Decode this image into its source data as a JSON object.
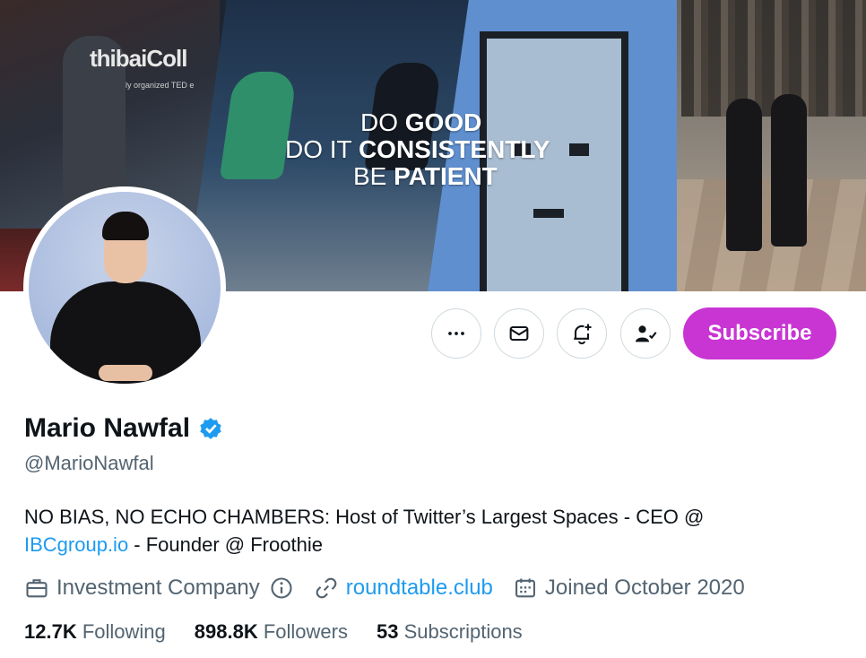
{
  "banner": {
    "quote": {
      "line1_thin": "DO ",
      "line1_bold": "GOOD",
      "line2_thin": "DO IT ",
      "line2_bold": "CONSISTENTLY",
      "line3_thin": "BE ",
      "line3_bold": "PATIENT"
    },
    "tedx_text": "thibaiColl",
    "tedx_sub": "ly organized TED e"
  },
  "actions": {
    "more_icon": "more-horizontal-icon",
    "message_icon": "envelope-icon",
    "notify_icon": "bell-plus-icon",
    "following_icon": "person-check-icon",
    "subscribe_label": "Subscribe"
  },
  "profile": {
    "name": "Mario Nawfal",
    "handle": "@MarioNawfal",
    "bio_text_1": "NO BIAS, NO ECHO CHAMBERS: Host of Twitter’s Largest Spaces - CEO @",
    "bio_link": "IBCgroup.io",
    "bio_text_2": " - Founder @ Froothie",
    "category": "Investment Company",
    "website": "roundtable.club",
    "joined": "Joined October 2020"
  },
  "stats": {
    "following_count": "12.7K",
    "following_label": "Following",
    "followers_count": "898.8K",
    "followers_label": "Followers",
    "subscriptions_count": "53",
    "subscriptions_label": "Subscriptions"
  },
  "colors": {
    "subscribe": "#c935d3",
    "link": "#1d9bf0",
    "verified": "#1d9bf0",
    "secondary_text": "#536471"
  }
}
